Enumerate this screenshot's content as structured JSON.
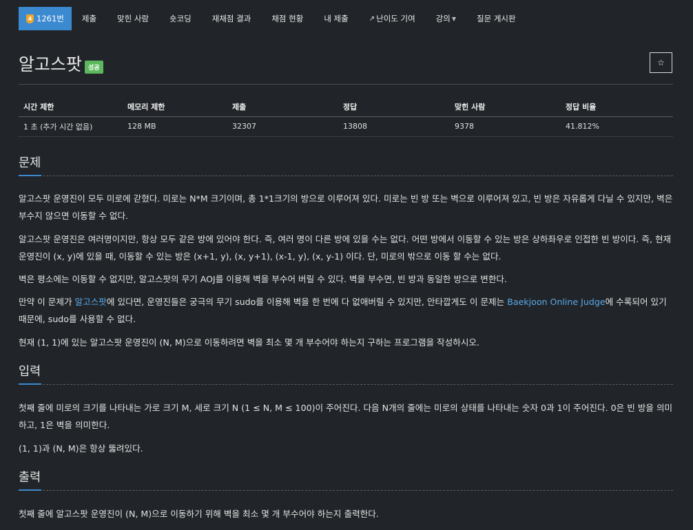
{
  "nav": {
    "problem_number": "1261번",
    "tier_icon": "4",
    "items": [
      "제출",
      "맞힌 사람",
      "숏코딩",
      "재채점 결과",
      "채점 현황",
      "내 제출",
      "난이도 기여",
      "강의",
      "질문 게시판"
    ]
  },
  "title": "알고스팟",
  "badge": "성공",
  "star_icon": "☆",
  "info_table": {
    "headers": [
      "시간 제한",
      "메모리 제한",
      "제출",
      "정답",
      "맞힌 사람",
      "정답 비율"
    ],
    "row": [
      "1 초 (추가 시간 없음)",
      "128 MB",
      "32307",
      "13808",
      "9378",
      "41.812%"
    ]
  },
  "sections": {
    "problem": "문제",
    "input": "입력",
    "output": "출력"
  },
  "problem": {
    "p1": "알고스팟 운영진이 모두 미로에 갇혔다. 미로는 N*M 크기이며, 총 1*1크기의 방으로 이루어져 있다. 미로는 빈 방 또는 벽으로 이루어져 있고, 빈 방은 자유롭게 다닐 수 있지만, 벽은 부수지 않으면 이동할 수 없다.",
    "p2": "알고스팟 운영진은 여러명이지만, 항상 모두 같은 방에 있어야 한다. 즉, 여러 명이 다른 방에 있을 수는 없다. 어떤 방에서 이동할 수 있는 방은 상하좌우로 인접한 빈 방이다. 즉, 현재 운영진이 (x, y)에 있을 때, 이동할 수 있는 방은 (x+1, y), (x, y+1), (x-1, y), (x, y-1) 이다. 단, 미로의 밖으로 이동 할 수는 없다.",
    "p3": "벽은 평소에는 이동할 수 없지만, 알고스팟의 무기 AOJ를 이용해 벽을 부수어 버릴 수 있다. 벽을 부수면, 빈 방과 동일한 방으로 변한다.",
    "p4_a": "만약 이 문제가 ",
    "p4_link1": "알고스팟",
    "p4_b": "에 있다면, 운영진들은 궁극의 무기 sudo를 이용해 벽을 한 번에 다 없애버릴 수 있지만, 안타깝게도 이 문제는 ",
    "p4_link2": "Baekjoon Online Judge",
    "p4_c": "에 수록되어 있기 때문에, sudo를 사용할 수 없다.",
    "p5": "현재 (1, 1)에 있는 알고스팟 운영진이 (N, M)으로 이동하려면 벽을 최소 몇 개 부수어야 하는지 구하는 프로그램을 작성하시오."
  },
  "input": {
    "p1": "첫째 줄에 미로의 크기를 나타내는 가로 크기 M, 세로 크기 N (1 ≤ N, M ≤ 100)이 주어진다. 다음 N개의 줄에는 미로의 상태를 나타내는 숫자 0과 1이 주어진다. 0은 빈 방을 의미하고, 1은 벽을 의미한다.",
    "p2": "(1, 1)과 (N, M)은 항상 뚫려있다."
  },
  "output": {
    "p1": "첫째 줄에 알고스팟 운영진이 (N, M)으로 이동하기 위해 벽을 최소 몇 개 부수어야 하는지 출력한다."
  }
}
